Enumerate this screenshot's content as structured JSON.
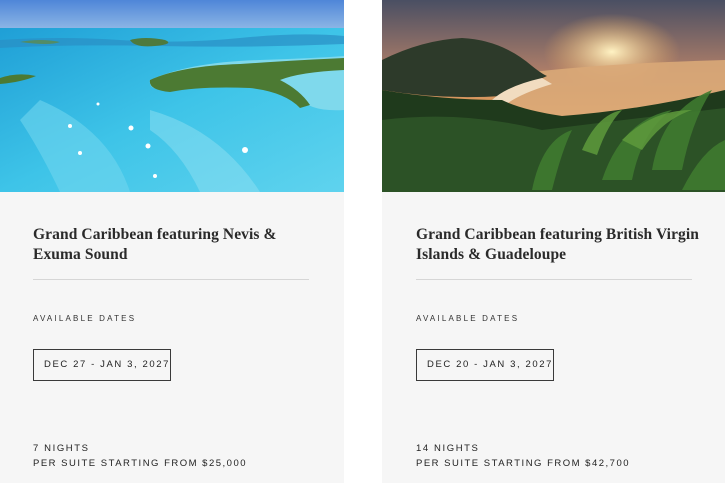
{
  "cards": [
    {
      "title": "Grand Caribbean featuring Nevis & Exuma Sound",
      "dates_label": "AVAILABLE DATES",
      "date_range": "DEC 27 - JAN 3, 2027",
      "nights": "7 NIGHTS",
      "price": "PER SUITE STARTING FROM $25,000",
      "image": "aerial-turquoise-lagoon-with-sailboats"
    },
    {
      "title": "Grand Caribbean featuring British Virgin Islands & Guadeloupe",
      "dates_label": "AVAILABLE DATES",
      "date_range": "DEC 20 - JAN 3, 2027",
      "nights": "14 NIGHTS",
      "price": "PER SUITE STARTING FROM $42,700",
      "image": "sunset-over-tropical-bay-with-palms"
    }
  ],
  "colors": {
    "card_bg": "#f6f6f6",
    "text": "#222222",
    "divider": "#d6d6d6",
    "border": "#3a3a3a"
  }
}
